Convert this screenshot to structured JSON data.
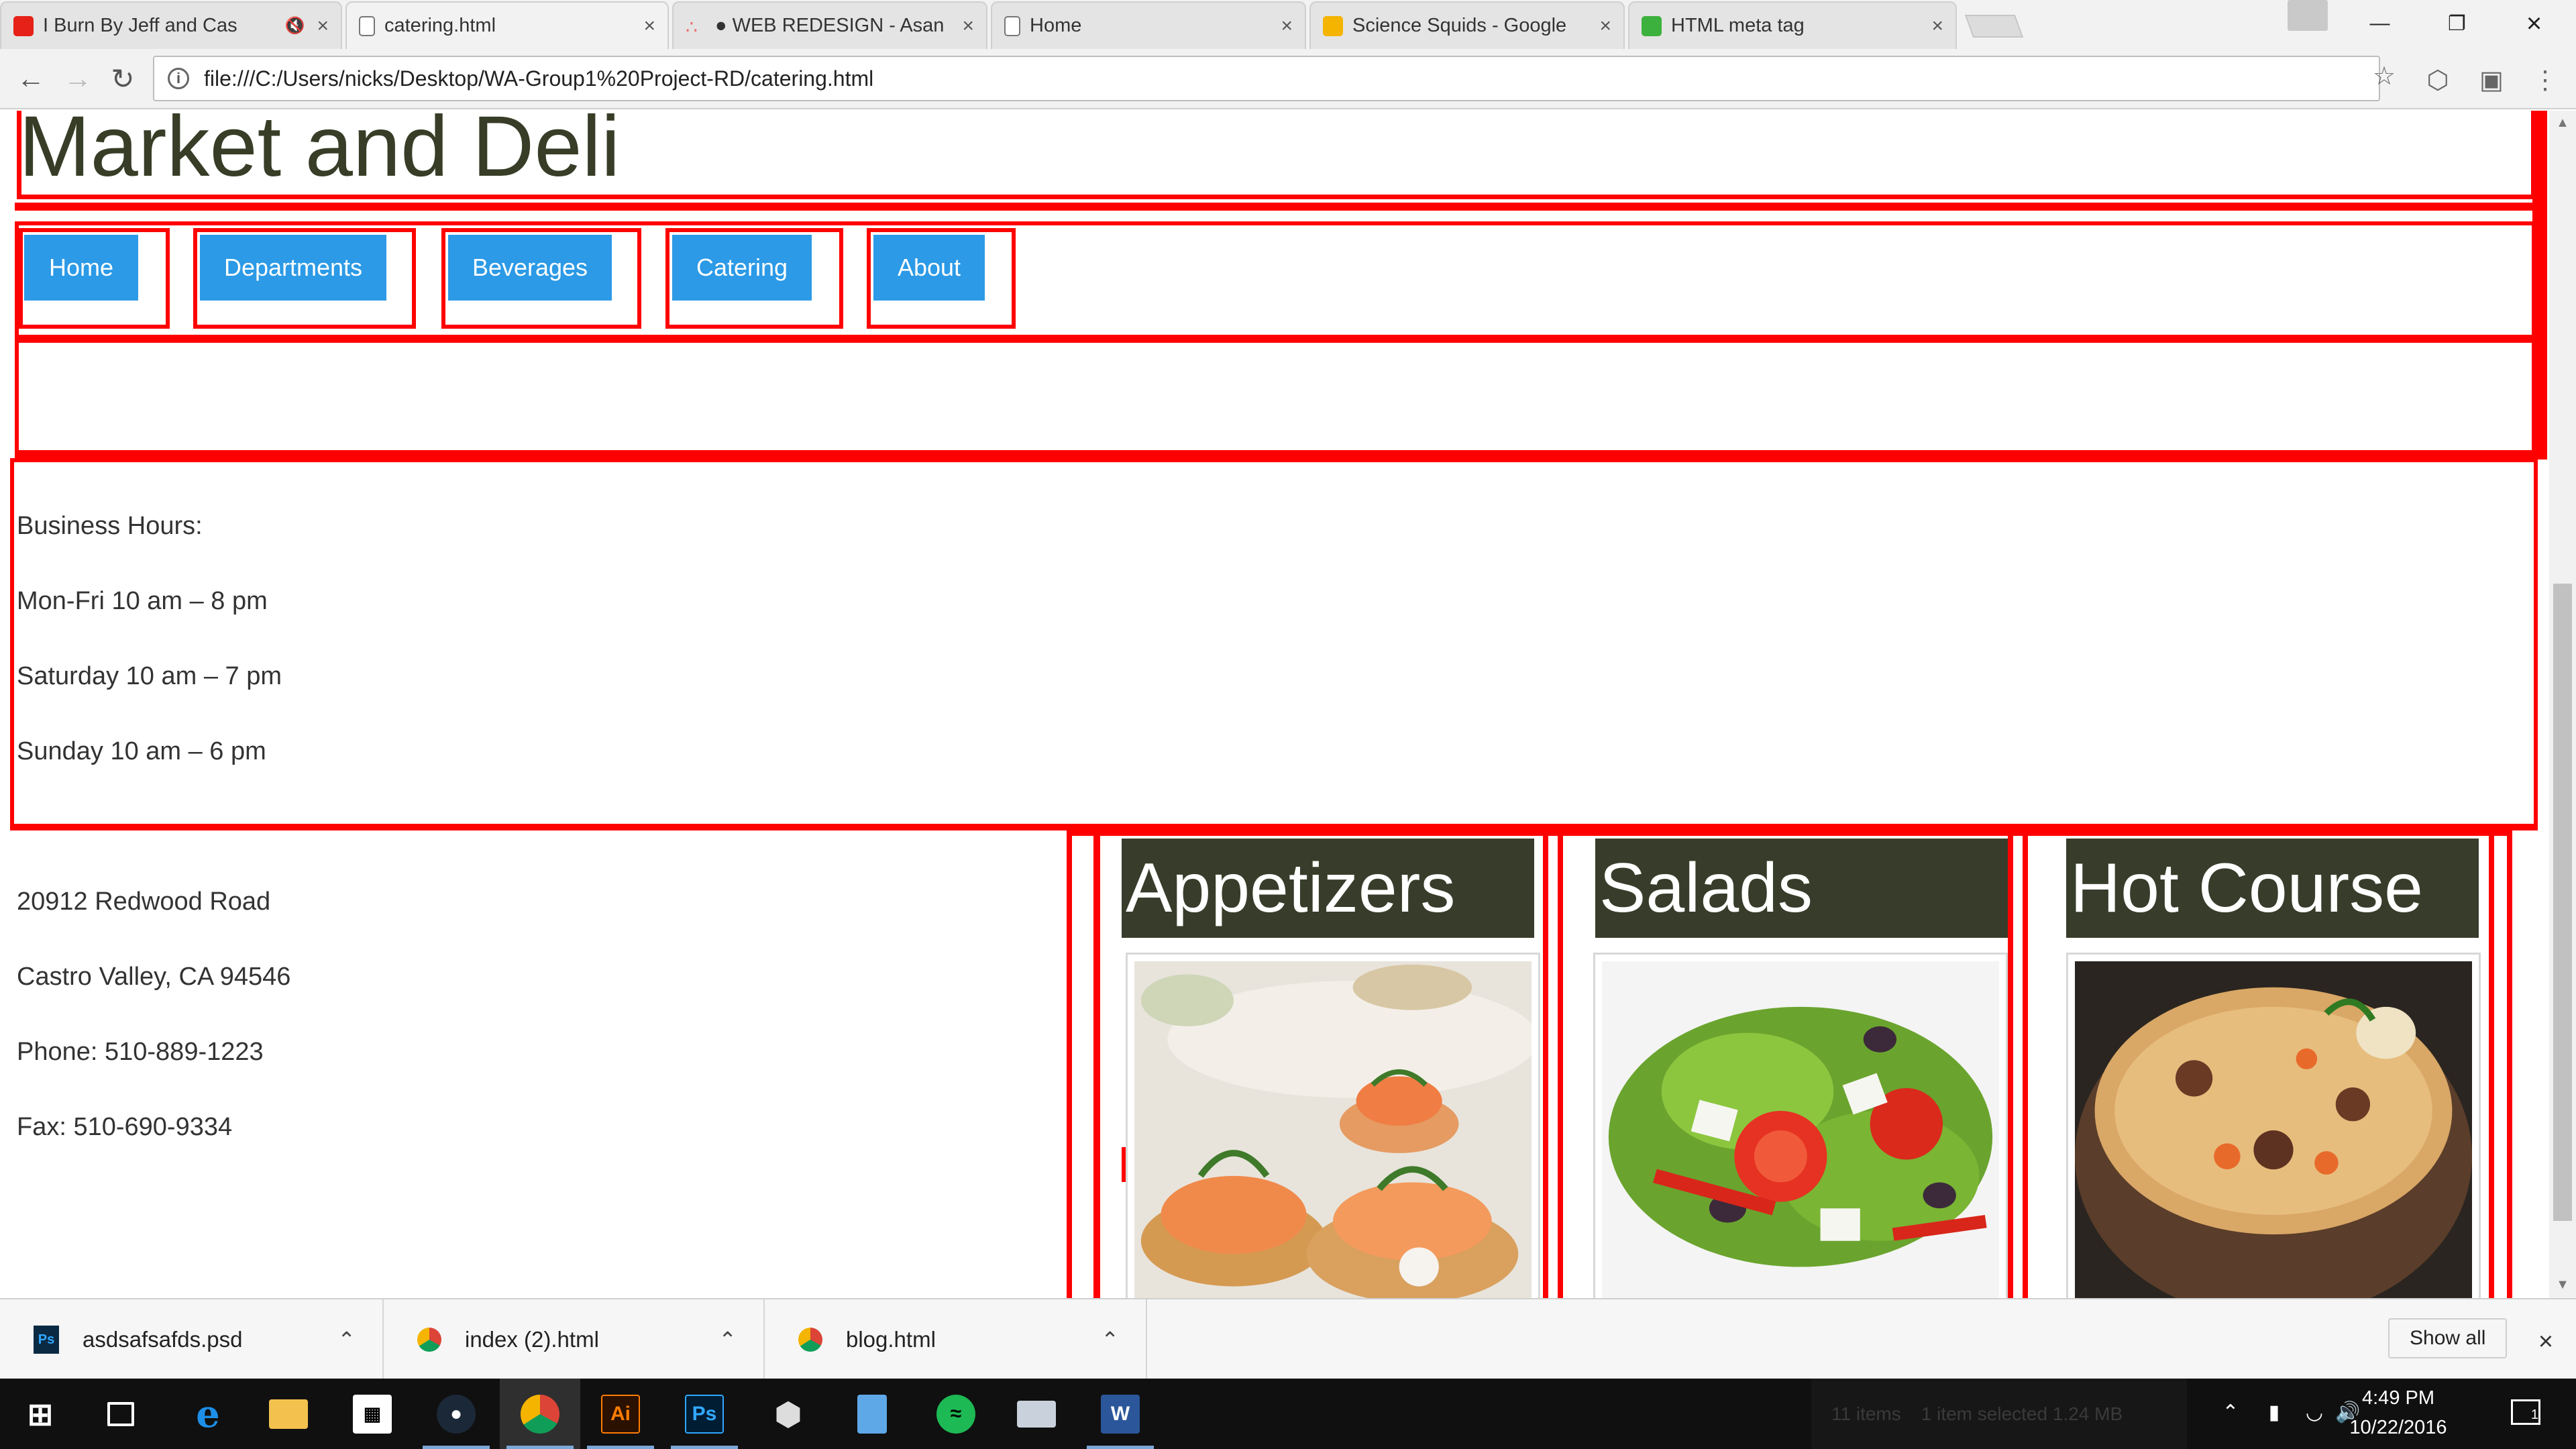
{
  "browser": {
    "tabs": [
      {
        "title": "I Burn By Jeff and Cas",
        "favicon_color": "#e62117",
        "muted_icon": "speaker-muted-icon"
      },
      {
        "title": "catering.html",
        "favicon_color": "#ffffff",
        "active": true
      },
      {
        "title": "● WEB REDESIGN - Asan",
        "favicon_color": "#f06a6a"
      },
      {
        "title": "Home",
        "favicon_color": "#ffffff"
      },
      {
        "title": "Science Squids - Google",
        "favicon_color": "#f4b400"
      },
      {
        "title": "HTML meta tag",
        "favicon_color": "#3db13d"
      }
    ],
    "address": "file:///C:/Users/nicks/Desktop/WA-Group1%20Project-RD/catering.html"
  },
  "page": {
    "heading": "Market and Deli",
    "nav": [
      "Home",
      "Departments",
      "Beverages",
      "Catering",
      "About"
    ],
    "hours_title": "Business Hours:",
    "hours_lines": [
      "Mon-Fri 10 am – 8 pm",
      "Saturday 10 am – 7 pm",
      "Sunday 10 am – 6 pm"
    ],
    "address_lines": [
      "20912 Redwood Road",
      "Castro Valley, CA 94546",
      "Phone: 510-889-1223",
      "Fax: 510-690-9334"
    ],
    "categories": [
      {
        "title": "Appetizers",
        "image": "appetizers-photo"
      },
      {
        "title": "Salads",
        "image": "salad-photo"
      },
      {
        "title": "Hot Course",
        "image": "rice-pilaf-photo"
      }
    ],
    "accent_color": "#2c9ae6",
    "border_color": "#ff0000",
    "category_bg": "#373d2a"
  },
  "downloads": {
    "items": [
      {
        "name": "asdsafsafds.psd",
        "icon": "photoshop-file-icon"
      },
      {
        "name": "index (2).html",
        "icon": "chrome-file-icon"
      },
      {
        "name": "blog.html",
        "icon": "chrome-file-icon"
      }
    ],
    "show_all": "Show all"
  },
  "taskbar": {
    "status_items": "11 items",
    "status_selected": "1 item selected  1.24 MB",
    "time": "4:49 PM",
    "date": "10/22/2016",
    "notification_count": "1"
  }
}
